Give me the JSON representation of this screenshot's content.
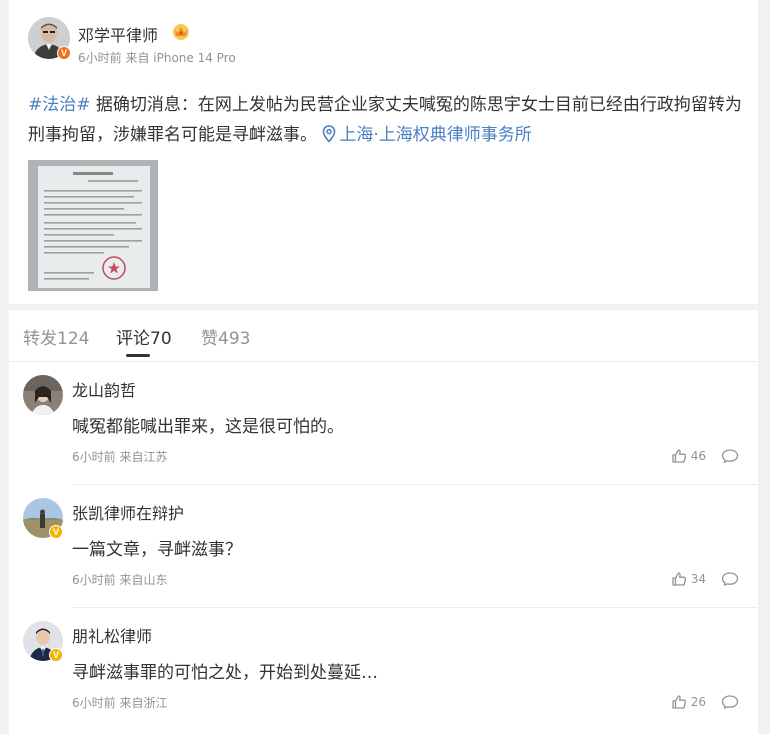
{
  "post": {
    "author": "邓学平律师",
    "meta": "6小时前 来自 iPhone 14 Pro",
    "hashtag": "#法治#",
    "body": " 据确切消息：在网上发帖为民营企业家丈夫喊冤的陈思宇女士目前已经由行政拘留转为刑事拘留，涉嫌罪名可能是寻衅滋事。",
    "location": "上海·上海权典律师事务所",
    "verified_badge": "V",
    "icons": [
      "crown-icon",
      "location-pin-icon",
      "document-image"
    ]
  },
  "tabs": [
    {
      "label": "转发",
      "count": "124"
    },
    {
      "label": "评论",
      "count": "70"
    },
    {
      "label": "赞",
      "count": "493"
    }
  ],
  "comments": [
    {
      "name": "龙山韵哲",
      "text": "喊冤都能喊出罪来，这是很可怕的。",
      "meta": "6小时前 来自江苏",
      "likes": "46",
      "verified": ""
    },
    {
      "name": "张凯律师在辩护",
      "text": "一篇文章，寻衅滋事？",
      "meta": "6小时前 来自山东",
      "likes": "34",
      "verified": "V"
    },
    {
      "name": "朋礼松律师",
      "text": "寻衅滋事罪的可怕之处，开始到处蔓延…",
      "meta": "6小时前 来自浙江",
      "likes": "26",
      "verified": "V"
    }
  ],
  "colors": {
    "link": "#4a7fc1",
    "orange_badge": "#f0701a",
    "gold_badge": "#f5b300",
    "muted": "#939393"
  }
}
